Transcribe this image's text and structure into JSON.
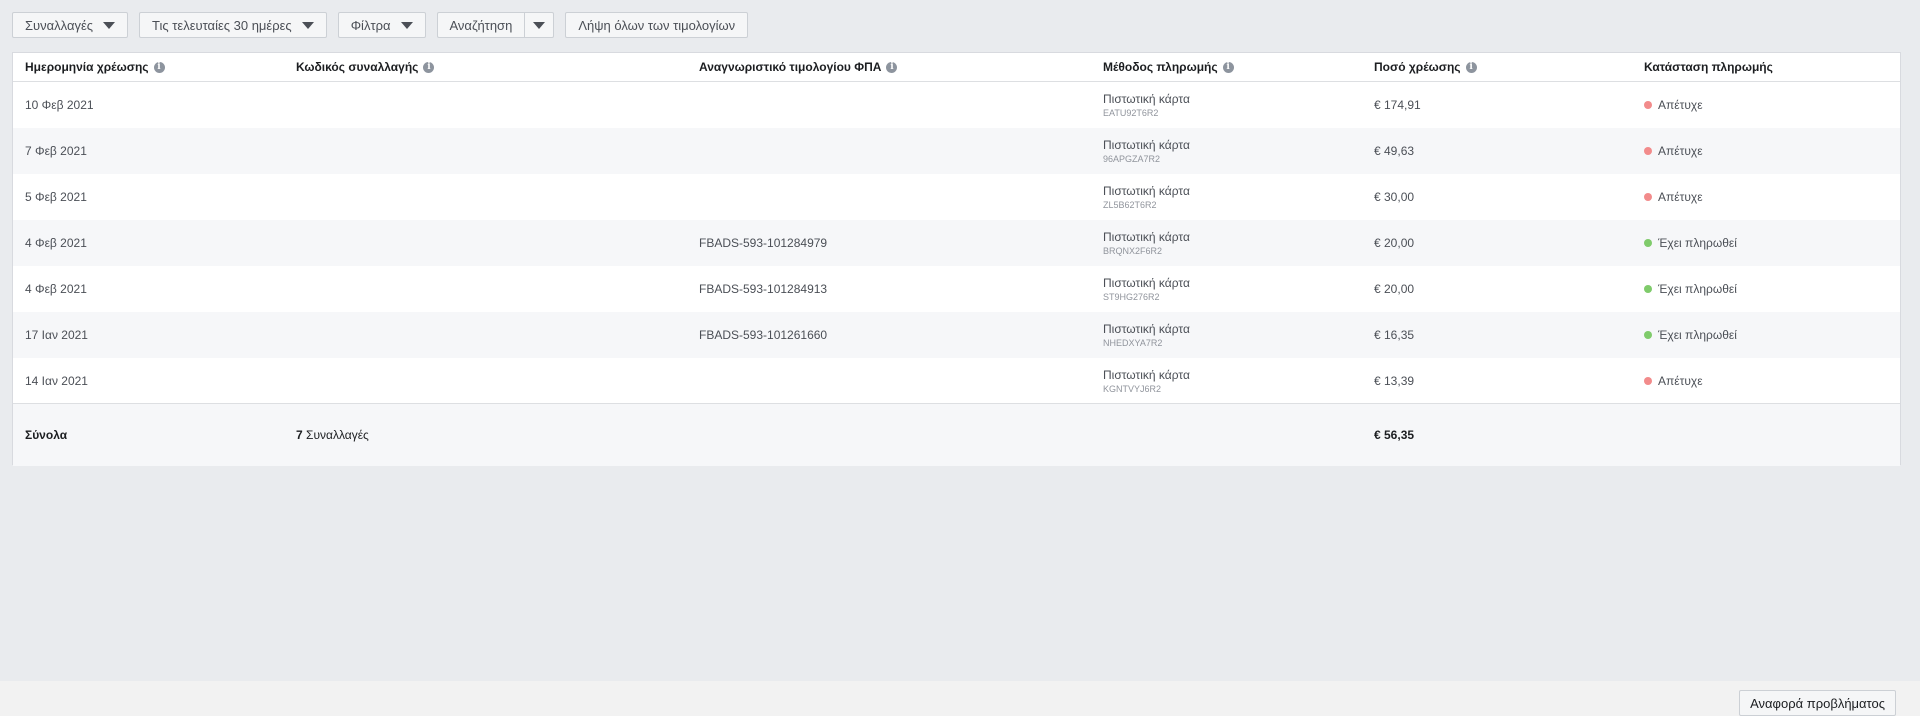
{
  "toolbar": {
    "transactions": "Συναλλαγές",
    "date_range": "Τις τελευταίες 30 ημέρες",
    "filters": "Φίλτρα",
    "search": "Αναζήτηση",
    "download_all": "Λήψη όλων των τιμολογίων"
  },
  "table": {
    "headers": {
      "date": "Ημερομηνία χρέωσης",
      "txn_id": "Κωδικός συναλλαγής",
      "vat_id": "Αναγνωριστικό τιμολογίου ΦΠΑ",
      "method": "Μέθοδος πληρωμής",
      "amount": "Ποσό χρέωσης",
      "status": "Κατάσταση πληρωμής"
    },
    "rows": [
      {
        "date": "10 Φεβ 2021",
        "txn_id": "",
        "vat_id": "",
        "method": "Πιστωτική κάρτα",
        "ref": "EATU92T6R2",
        "amount": "€ 174,91",
        "status": "Απέτυχε",
        "status_color": "#f28b8b"
      },
      {
        "date": "7 Φεβ 2021",
        "txn_id": "",
        "vat_id": "",
        "method": "Πιστωτική κάρτα",
        "ref": "96APGZA7R2",
        "amount": "€ 49,63",
        "status": "Απέτυχε",
        "status_color": "#f28b8b"
      },
      {
        "date": "5 Φεβ 2021",
        "txn_id": "",
        "vat_id": "",
        "method": "Πιστωτική κάρτα",
        "ref": "ZL5B62T6R2",
        "amount": "€ 30,00",
        "status": "Απέτυχε",
        "status_color": "#f28b8b"
      },
      {
        "date": "4 Φεβ 2021",
        "txn_id": "",
        "vat_id": "FBADS-593-101284979",
        "method": "Πιστωτική κάρτα",
        "ref": "BRQNX2F6R2",
        "amount": "€ 20,00",
        "status": "Έχει πληρωθεί",
        "status_color": "#7fcb6b"
      },
      {
        "date": "4 Φεβ 2021",
        "txn_id": "",
        "vat_id": "FBADS-593-101284913",
        "method": "Πιστωτική κάρτα",
        "ref": "ST9HG276R2",
        "amount": "€ 20,00",
        "status": "Έχει πληρωθεί",
        "status_color": "#7fcb6b"
      },
      {
        "date": "17 Ιαν 2021",
        "txn_id": "",
        "vat_id": "FBADS-593-101261660",
        "method": "Πιστωτική κάρτα",
        "ref": "NHEDXYA7R2",
        "amount": "€ 16,35",
        "status": "Έχει πληρωθεί",
        "status_color": "#7fcb6b"
      },
      {
        "date": "14 Ιαν 2021",
        "txn_id": "",
        "vat_id": "",
        "method": "Πιστωτική κάρτα",
        "ref": "KGNTVYJ6R2",
        "amount": "€ 13,39",
        "status": "Απέτυχε",
        "status_color": "#f28b8b"
      }
    ],
    "totals": {
      "label": "Σύνολα",
      "count": "7",
      "count_label": "Συναλλαγές",
      "amount": "€ 56,35"
    }
  },
  "footer": {
    "report_problem": "Αναφορά προβλήματος"
  }
}
